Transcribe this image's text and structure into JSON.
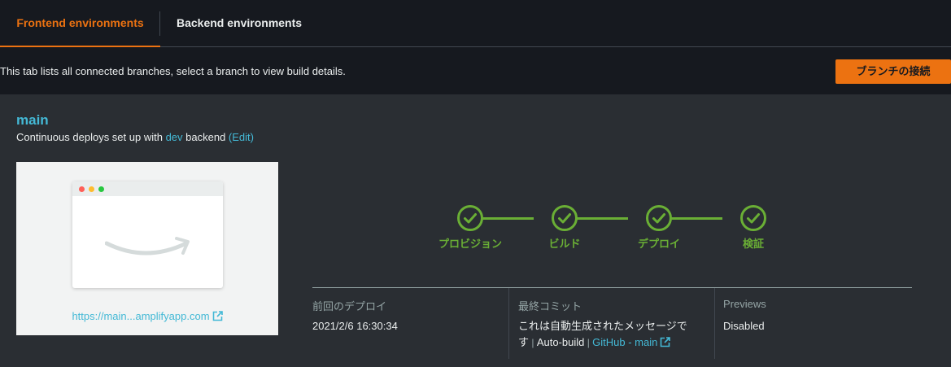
{
  "tabs": {
    "frontend": "Frontend environments",
    "backend": "Backend environments"
  },
  "infobar": {
    "description": "This tab lists all connected branches, select a branch to view build details.",
    "connect_button": "ブランチの接続"
  },
  "branch": {
    "name": "main",
    "sub_prefix": "Continuous deploys set up with ",
    "backend_link": "dev",
    "sub_mid": " backend ",
    "edit_link": "(Edit)",
    "url": "https://main...amplifyapp.com"
  },
  "pipeline": {
    "stages": [
      "プロビジョン",
      "ビルド",
      "デプロイ",
      "検証"
    ],
    "status_color": "#6aaf35"
  },
  "meta": {
    "last_deploy_label": "前回のデプロイ",
    "last_deploy_value": "2021/2/6 16:30:34",
    "last_commit_label": "最終コミット",
    "commit_line1": "これは自動生成されたメッセージで",
    "commit_line2_prefix": "す",
    "commit_sep": " | ",
    "commit_author": "Auto-build",
    "commit_link": "GitHub - main",
    "previews_label": "Previews",
    "previews_value": "Disabled"
  },
  "colors": {
    "accent": "#ec7211",
    "link": "#44b9d6",
    "success": "#6aaf35"
  }
}
